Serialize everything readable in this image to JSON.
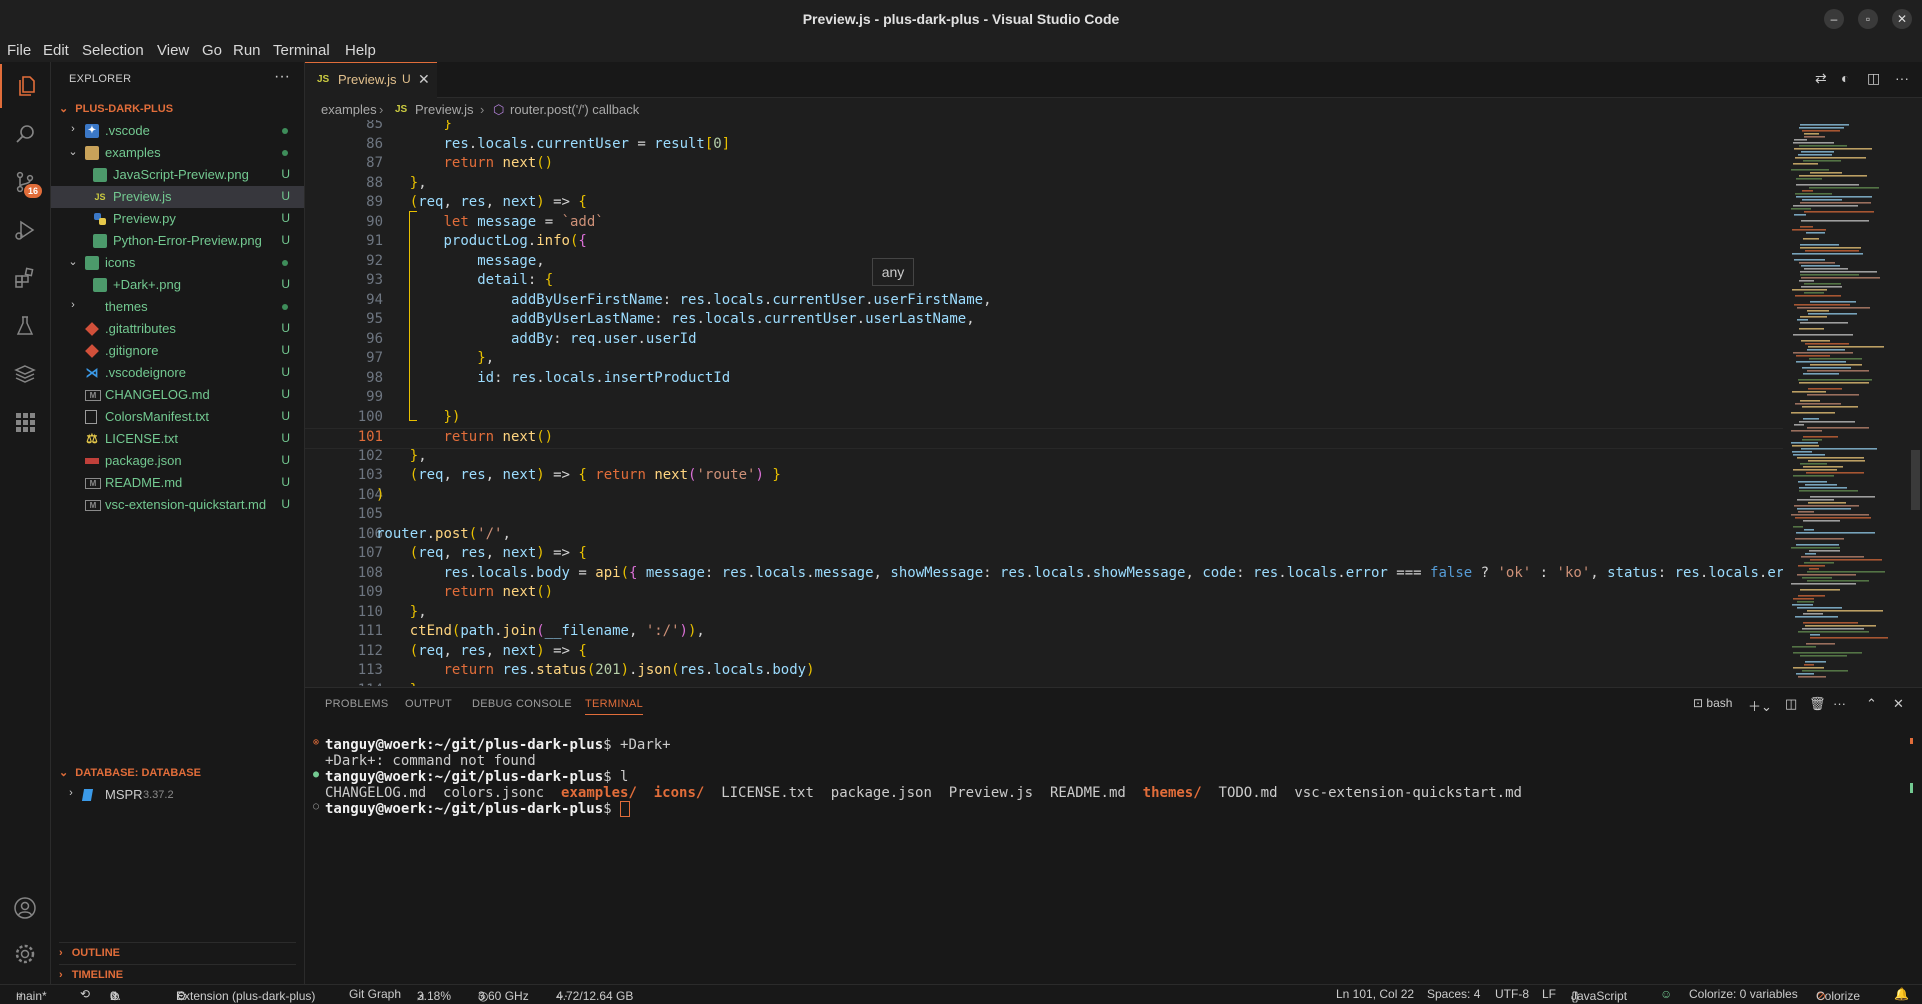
{
  "window": {
    "title": "Preview.js - plus-dark-plus - Visual Studio Code"
  },
  "menu": [
    "File",
    "Edit",
    "Selection",
    "View",
    "Go",
    "Run",
    "Terminal",
    "Help"
  ],
  "activity": {
    "scm_badge": "16"
  },
  "explorer": {
    "header": "EXPLORER",
    "root": "PLUS-DARK-PLUS",
    "items": [
      {
        "label": ".vscode",
        "status": ""
      },
      {
        "label": "examples",
        "status": ""
      },
      {
        "label": "JavaScript-Preview.png",
        "status": "U"
      },
      {
        "label": "Preview.js",
        "status": "U"
      },
      {
        "label": "Preview.py",
        "status": "U"
      },
      {
        "label": "Python-Error-Preview.png",
        "status": "U"
      },
      {
        "label": "icons",
        "status": ""
      },
      {
        "label": "+Dark+.png",
        "status": "U"
      },
      {
        "label": "themes",
        "status": ""
      },
      {
        "label": ".gitattributes",
        "status": "U"
      },
      {
        "label": ".gitignore",
        "status": "U"
      },
      {
        "label": ".vscodeignore",
        "status": "U"
      },
      {
        "label": "CHANGELOG.md",
        "status": "U"
      },
      {
        "label": "ColorsManifest.txt",
        "status": "U"
      },
      {
        "label": "LICENSE.txt",
        "status": "U"
      },
      {
        "label": "package.json",
        "status": "U"
      },
      {
        "label": "README.md",
        "status": "U"
      },
      {
        "label": "vsc-extension-quickstart.md",
        "status": "U"
      }
    ],
    "database_section": "DATABASE: DATABASE",
    "db_name": "MSPR",
    "db_version": "3.37.2",
    "outline": "OUTLINE",
    "timeline": "TIMELINE"
  },
  "editor": {
    "tab": {
      "icon": "JS",
      "name": "Preview.js",
      "status": "U"
    },
    "breadcrumb": [
      "examples",
      "Preview.js",
      "router.post('/') callback"
    ],
    "hover_text": "any",
    "lines": [
      {
        "n": "85",
        "text": "        }"
      },
      {
        "n": "86",
        "text": "        res.locals.currentUser = result[0]"
      },
      {
        "n": "87",
        "text": "        return next()"
      },
      {
        "n": "88",
        "text": "    },"
      },
      {
        "n": "89",
        "text": "    (req, res, next) => {"
      },
      {
        "n": "90",
        "text": "        let message = `add`"
      },
      {
        "n": "91",
        "text": "        productLog.info({"
      },
      {
        "n": "92",
        "text": "            message,"
      },
      {
        "n": "93",
        "text": "            detail: {"
      },
      {
        "n": "94",
        "text": "                addByUserFirstName: res.locals.currentUser.userFirstName,"
      },
      {
        "n": "95",
        "text": "                addByUserLastName: res.locals.currentUser.userLastName,"
      },
      {
        "n": "96",
        "text": "                addBy: req.user.userId"
      },
      {
        "n": "97",
        "text": "            },"
      },
      {
        "n": "98",
        "text": "            id: res.locals.insertProductId"
      },
      {
        "n": "99",
        "text": ""
      },
      {
        "n": "100",
        "text": "        })"
      },
      {
        "n": "101",
        "text": "        return next()"
      },
      {
        "n": "102",
        "text": "    },"
      },
      {
        "n": "103",
        "text": "    (req, res, next) => { return next('route') }"
      },
      {
        "n": "104",
        "text": ")"
      },
      {
        "n": "105",
        "text": ""
      },
      {
        "n": "106",
        "text": "router.post('/',"
      },
      {
        "n": "107",
        "text": "    (req, res, next) => {"
      },
      {
        "n": "108",
        "text": "        res.locals.body = api({ message: res.locals.message, showMessage: res.locals.showMessage, code: res.locals.error === false ? 'ok' : 'ko', status: res.locals.error === false ?"
      },
      {
        "n": "109",
        "text": "        return next()"
      },
      {
        "n": "110",
        "text": "    },"
      },
      {
        "n": "111",
        "text": "    ctEnd(path.join(__filename, ':/')),"
      },
      {
        "n": "112",
        "text": "    (req, res, next) => {"
      },
      {
        "n": "113",
        "text": "        return res.status(201).json(res.locals.body)"
      },
      {
        "n": "114",
        "text": "    }"
      }
    ]
  },
  "panel": {
    "tabs": [
      "PROBLEMS",
      "OUTPUT",
      "DEBUG CONSOLE",
      "TERMINAL"
    ],
    "shell": "bash",
    "prompt_user": "tanguy@woerk",
    "prompt_path": ":~/git/plus-dark-plus",
    "cmd1": "$ +Dark+",
    "out1": "+Dark+: command not found",
    "cmd2": "$ l",
    "ls": [
      {
        "name": "CHANGELOG.md",
        "dir": false
      },
      {
        "name": "colors.jsonc",
        "dir": false
      },
      {
        "name": "examples/",
        "dir": true
      },
      {
        "name": "icons/",
        "dir": true
      },
      {
        "name": "LICENSE.txt",
        "dir": false
      },
      {
        "name": "package.json",
        "dir": false
      },
      {
        "name": "Preview.js",
        "dir": false
      },
      {
        "name": "README.md",
        "dir": false
      },
      {
        "name": "themes/",
        "dir": true
      },
      {
        "name": "TODO.md",
        "dir": false
      },
      {
        "name": "vsc-extension-quickstart.md",
        "dir": false
      }
    ],
    "cmd3": "$ "
  },
  "statusbar": {
    "branch": "main*",
    "errors": "0",
    "warnings": "0",
    "extension": "Extension (plus-dark-plus)",
    "gitgraph": "Git Graph",
    "cpu": "3.18%",
    "freq": "3.60 GHz",
    "mem": "4.72/12.64 GB",
    "position": "Ln 101, Col 22",
    "spaces": "Spaces: 4",
    "encoding": "UTF-8",
    "eol": "LF",
    "language": "JavaScript",
    "colorize_vars": "Colorize: 0 variables",
    "colorize": "Colorize"
  },
  "colors": {
    "accent": "#e16d3a",
    "untracked": "#73c991",
    "background": "#1e1e1e"
  }
}
